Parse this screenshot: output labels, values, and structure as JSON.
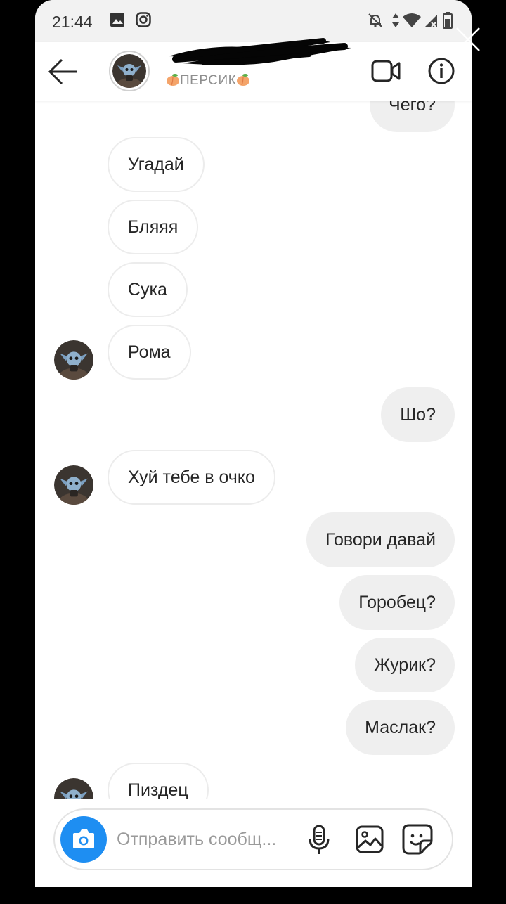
{
  "status_bar": {
    "time": "21:44"
  },
  "header": {
    "username_prefix": "_",
    "display_name": "ПЕРСИК"
  },
  "messages": [
    {
      "direction": "out",
      "text": "Чего?"
    },
    {
      "direction": "in",
      "text": "Угадай"
    },
    {
      "direction": "in",
      "text": "Бляяя"
    },
    {
      "direction": "in",
      "text": "Сука"
    },
    {
      "direction": "in",
      "text": "Рома"
    },
    {
      "direction": "out",
      "text": "Шо?"
    },
    {
      "direction": "in",
      "text": "Хуй тебе в очко"
    },
    {
      "direction": "out",
      "text": "Говори давай"
    },
    {
      "direction": "out",
      "text": "Горобец?"
    },
    {
      "direction": "out",
      "text": "Журик?"
    },
    {
      "direction": "out",
      "text": "Маслак?"
    },
    {
      "direction": "in",
      "text": "Пиздец"
    }
  ],
  "composer": {
    "placeholder": "Отправить сообщ..."
  },
  "colors": {
    "accent": "#1e8ef2",
    "incoming_bubble_border": "#ececec",
    "outgoing_bubble_bg": "#efefef",
    "peach": "#f4a46a"
  },
  "icons": [
    "back-arrow-icon",
    "video-camera-icon",
    "info-icon",
    "camera-icon",
    "microphone-icon",
    "gallery-icon",
    "sticker-icon",
    "close-icon"
  ]
}
